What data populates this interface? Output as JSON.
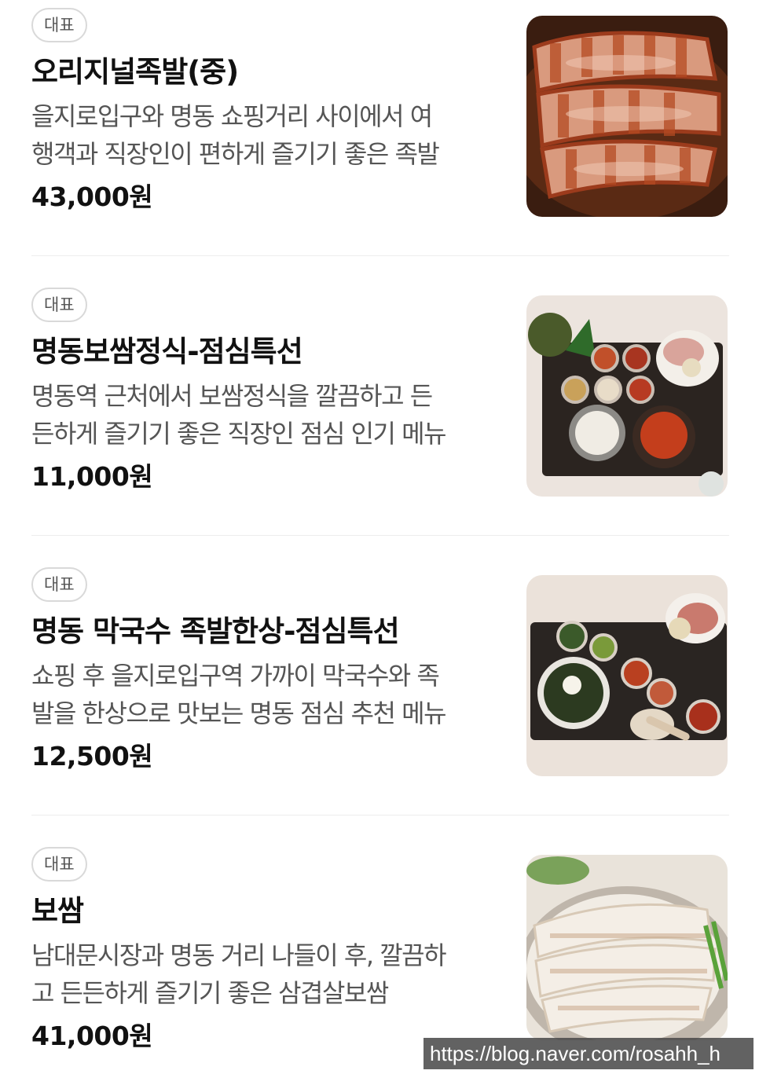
{
  "menu": {
    "items": [
      {
        "badge": "대표",
        "title": "오리지널족발(중)",
        "desc_line1": "을지로입구와 명동 쇼핑거리 사이에서 여",
        "desc_line2": "행객과 직장인이 편하게 즐기기 좋은 족발",
        "price": "43,000원",
        "image": "jokbal-photo"
      },
      {
        "badge": "대표",
        "title": "명동보쌈정식-점심특선",
        "desc_line1": "명동역 근처에서 보쌈정식을 깔끔하고 든",
        "desc_line2": "든하게 즐기기 좋은 직장인 점심 인기 메뉴",
        "price": "11,000원",
        "image": "bossam-set-photo"
      },
      {
        "badge": "대표",
        "title": "명동 막국수 족발한상-점심특선",
        "desc_line1": "쇼핑 후 을지로입구역 가까이 막국수와 족",
        "desc_line2": "발을 한상으로 맛보는 명동 점심 추천 메뉴",
        "price": "12,500원",
        "image": "makguksu-set-photo"
      },
      {
        "badge": "대표",
        "title": "보쌈",
        "desc_line1": "남대문시장과 명동 거리 나들이 후, 깔끔하",
        "desc_line2": "고 든든하게 즐기기 좋은 삼겹살보쌈",
        "price": "41,000원",
        "image": "bossam-photo"
      }
    ]
  },
  "watermark": "https://blog.naver.com/rosahh_h"
}
